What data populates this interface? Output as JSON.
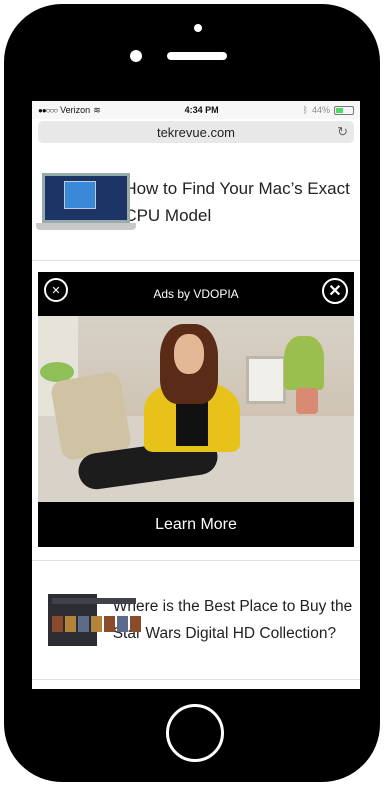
{
  "status_bar": {
    "carrier": "Verizon",
    "time": "4:34 PM",
    "battery": "44%",
    "battery_level": 0.44
  },
  "url_bar": {
    "domain": "tekrevue.com"
  },
  "articles": [
    {
      "title": "How to Find Your Mac’s Exact CPU Model"
    },
    {
      "title": "Where is the Best Place to Buy the Star Wars Digital HD Collection?"
    }
  ],
  "ad": {
    "header": "Ads by VDOPIA",
    "cta": "Learn More"
  },
  "icons": {
    "reload": "reload-icon",
    "mute": "mute-icon",
    "close": "close-icon",
    "wifi": "wifi-icon",
    "bluetooth": "bluetooth-icon",
    "battery": "battery-icon"
  }
}
